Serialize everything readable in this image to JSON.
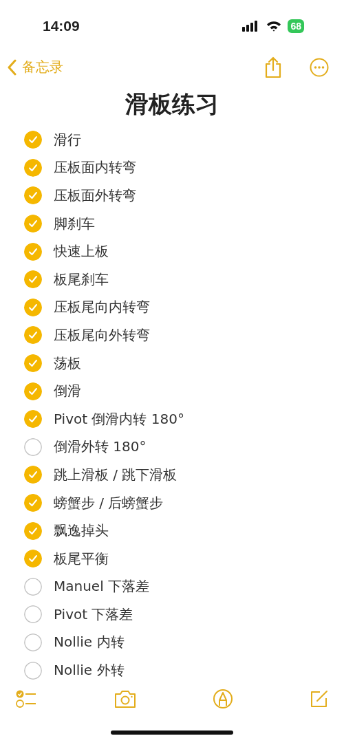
{
  "status_bar": {
    "time": "14:09",
    "battery": "68"
  },
  "nav": {
    "back_label": "备忘录"
  },
  "note": {
    "title": "滑板练习",
    "items": [
      {
        "text": "滑行",
        "checked": true
      },
      {
        "text": "压板面内转弯",
        "checked": true
      },
      {
        "text": "压板面外转弯",
        "checked": true
      },
      {
        "text": "脚刹车",
        "checked": true
      },
      {
        "text": "快速上板",
        "checked": true
      },
      {
        "text": "板尾刹车",
        "checked": true
      },
      {
        "text": "压板尾向内转弯",
        "checked": true
      },
      {
        "text": "压板尾向外转弯",
        "checked": true
      },
      {
        "text": "荡板",
        "checked": true
      },
      {
        "text": "倒滑",
        "checked": true
      },
      {
        "text": "Pivot 倒滑内转 180°",
        "checked": true
      },
      {
        "text": "倒滑外转 180°",
        "checked": false
      },
      {
        "text": "跳上滑板 / 跳下滑板",
        "checked": true
      },
      {
        "text": "螃蟹步 / 后螃蟹步",
        "checked": true
      },
      {
        "text": "飘逸掉头",
        "checked": true
      },
      {
        "text": "板尾平衡",
        "checked": true
      },
      {
        "text": "Manuel 下落差",
        "checked": false
      },
      {
        "text": "Pivot 下落差",
        "checked": false
      },
      {
        "text": "Nollie 内转",
        "checked": false
      },
      {
        "text": "Nollie 外转",
        "checked": false
      }
    ]
  }
}
